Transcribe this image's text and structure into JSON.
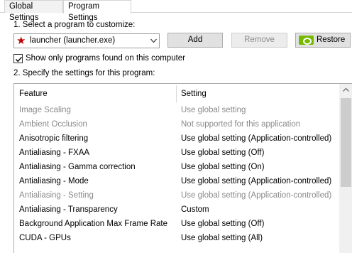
{
  "tabs": [
    {
      "label": "Global Settings"
    },
    {
      "label": "Program Settings"
    }
  ],
  "select_program": {
    "label": "1. Select a program to customize:",
    "selected": "launcher (launcher.exe)",
    "icon": "star-icon"
  },
  "buttons": {
    "add": "Add",
    "remove": "Remove",
    "restore": "Restore"
  },
  "filter": {
    "label": "Show only programs found on this computer",
    "checked": true
  },
  "specify": {
    "label": "2. Specify the settings for this program:"
  },
  "table": {
    "columns": [
      "Feature",
      "Setting"
    ],
    "rows": [
      {
        "feature": "Image Scaling",
        "setting": "Use global setting",
        "dim": true
      },
      {
        "feature": "Ambient Occlusion",
        "setting": "Not supported for this application",
        "dim": true
      },
      {
        "feature": "Anisotropic filtering",
        "setting": "Use global setting (Application-controlled)",
        "dim": false
      },
      {
        "feature": "Antialiasing - FXAA",
        "setting": "Use global setting (Off)",
        "dim": false
      },
      {
        "feature": "Antialiasing - Gamma correction",
        "setting": "Use global setting (On)",
        "dim": false
      },
      {
        "feature": "Antialiasing - Mode",
        "setting": "Use global setting (Application-controlled)",
        "dim": false
      },
      {
        "feature": "Antialiasing - Setting",
        "setting": "Use global setting (Application-controlled)",
        "dim": true
      },
      {
        "feature": "Antialiasing - Transparency",
        "setting": "Custom",
        "dim": false
      },
      {
        "feature": "Background Application Max Frame Rate",
        "setting": "Use global setting (Off)",
        "dim": false
      },
      {
        "feature": "CUDA - GPUs",
        "setting": "Use global setting (All)",
        "dim": false
      }
    ]
  },
  "colors": {
    "accent_star": "#c00000",
    "nvidia_green": "#76b900",
    "dim_text": "#8a8a8a"
  }
}
